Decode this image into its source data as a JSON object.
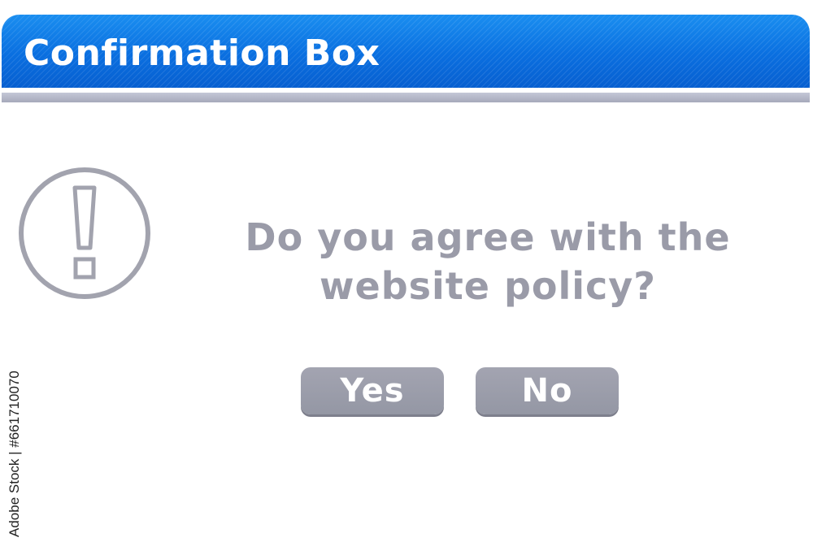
{
  "dialog": {
    "title": "Confirmation Box",
    "message_line1": "Do you agree with the",
    "message_line2": "website policy?",
    "icon": "exclamation-circle-icon",
    "buttons": {
      "yes_label": "Yes",
      "no_label": "No"
    }
  },
  "watermark": {
    "stock_id": "Adobe Stock | #661710070"
  },
  "colors": {
    "title_bar": "#0a6fe0",
    "title_text": "#ffffff",
    "underline": "#b3b6c8",
    "message_text": "#9a9ba8",
    "button_bg": "#9b9ca9",
    "icon_stroke": "#a2a3ae"
  }
}
